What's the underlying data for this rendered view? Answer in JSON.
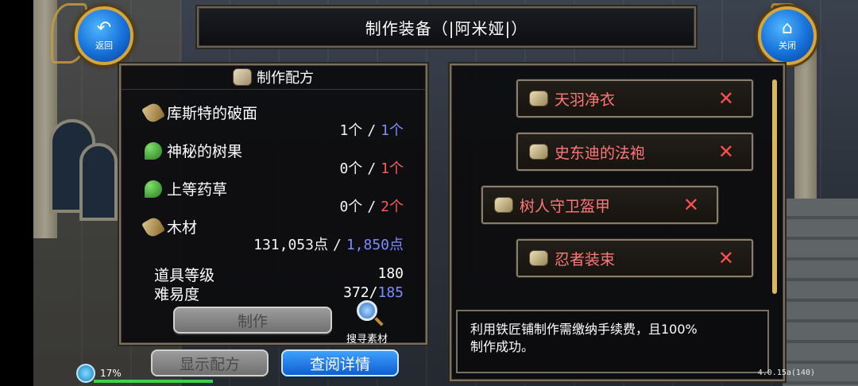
{
  "window": {
    "title": "制作装备（|阿米娅|）"
  },
  "nav": {
    "back_label": "返回",
    "close_label": "关闭"
  },
  "recipe_panel": {
    "header": "制作配方",
    "materials": [
      {
        "name": "库斯特的破面",
        "icon": "scroll-icon",
        "have": "1个",
        "need": "1个",
        "enough": true
      },
      {
        "name": "神秘的树果",
        "icon": "leaf-icon",
        "have": "0个",
        "need": "1个",
        "enough": false
      },
      {
        "name": "上等药草",
        "icon": "leaf-icon",
        "have": "0个",
        "need": "2个",
        "enough": false
      },
      {
        "name": "木材",
        "icon": "scroll-icon",
        "have": "131,053点",
        "need": "1,850点",
        "enough": true
      }
    ],
    "item_level_label": "道具等级",
    "item_level_value": "180",
    "difficulty_label": "难易度",
    "difficulty_have": "372/",
    "difficulty_need": "185",
    "craft_button": "制作",
    "search_label": "搜寻素材"
  },
  "bottom_buttons": {
    "show_recipe": "显示配方",
    "view_details": "查阅详情"
  },
  "equipment_list": [
    {
      "name": "天羽净衣"
    },
    {
      "name": "史东迪的法袍"
    },
    {
      "name": "树人守卫盔甲"
    },
    {
      "name": "忍者装束"
    }
  ],
  "info_text_line1": "利用铁匠铺制作需缴纳手续费，且100%",
  "info_text_line2": "制作成功。",
  "status": {
    "battery": "17%",
    "version": "4.0.15a(140)"
  },
  "colors": {
    "need_enough": "#7d8cff",
    "need_lacking": "#ff5a5a",
    "item_name": "#ff7878",
    "accent_blue": "#1670d8"
  }
}
